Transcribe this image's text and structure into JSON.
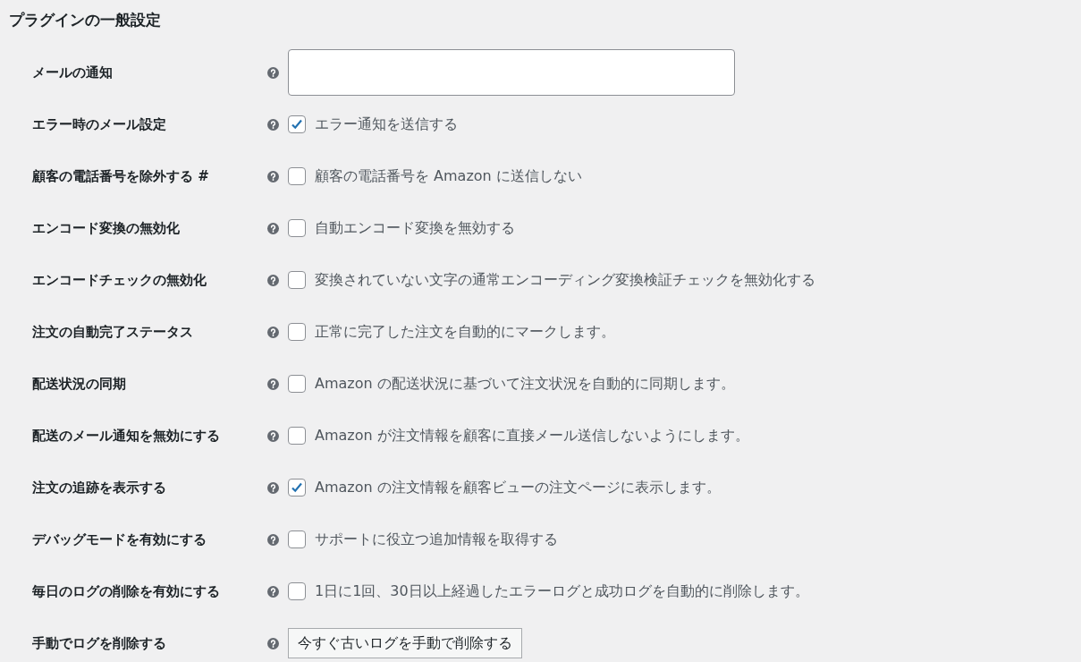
{
  "heading": "プラグインの一般設定",
  "settings": [
    {
      "kind": "text",
      "label": "メールの通知"
    },
    {
      "kind": "checkbox",
      "label": "エラー時のメール設定",
      "checked": true,
      "description": "エラー通知を送信する"
    },
    {
      "kind": "checkbox",
      "label": "顧客の電話番号を除外する #",
      "checked": false,
      "description": "顧客の電話番号を Amazon に送信しない"
    },
    {
      "kind": "checkbox",
      "label": "エンコード変換の無効化",
      "checked": false,
      "description": "自動エンコード変換を無効する"
    },
    {
      "kind": "checkbox",
      "label": "エンコードチェックの無効化",
      "checked": false,
      "description": "変換されていない文字の通常エンコーディング変換検証チェックを無効化する"
    },
    {
      "kind": "checkbox",
      "label": "注文の自動完了ステータス",
      "checked": false,
      "description": "正常に完了した注文を自動的にマークします。"
    },
    {
      "kind": "checkbox",
      "label": "配送状況の同期",
      "checked": false,
      "description": "Amazon の配送状況に基づいて注文状況を自動的に同期します。"
    },
    {
      "kind": "checkbox",
      "label": "配送のメール通知を無効にする",
      "checked": false,
      "description": "Amazon が注文情報を顧客に直接メール送信しないようにします。"
    },
    {
      "kind": "checkbox",
      "label": "注文の追跡を表示する",
      "checked": true,
      "description": "Amazon の注文情報を顧客ビューの注文ページに表示します。"
    },
    {
      "kind": "checkbox",
      "label": "デバッグモードを有効にする",
      "checked": false,
      "description": "サポートに役立つ追加情報を取得する"
    },
    {
      "kind": "checkbox",
      "label": "毎日のログの削除を有効にする",
      "checked": false,
      "description": "1日に1回、30日以上経過したエラーログと成功ログを自動的に削除します。"
    },
    {
      "kind": "button",
      "label": "手動でログを削除する",
      "button": "今すぐ古いログを手動で削除する"
    }
  ]
}
